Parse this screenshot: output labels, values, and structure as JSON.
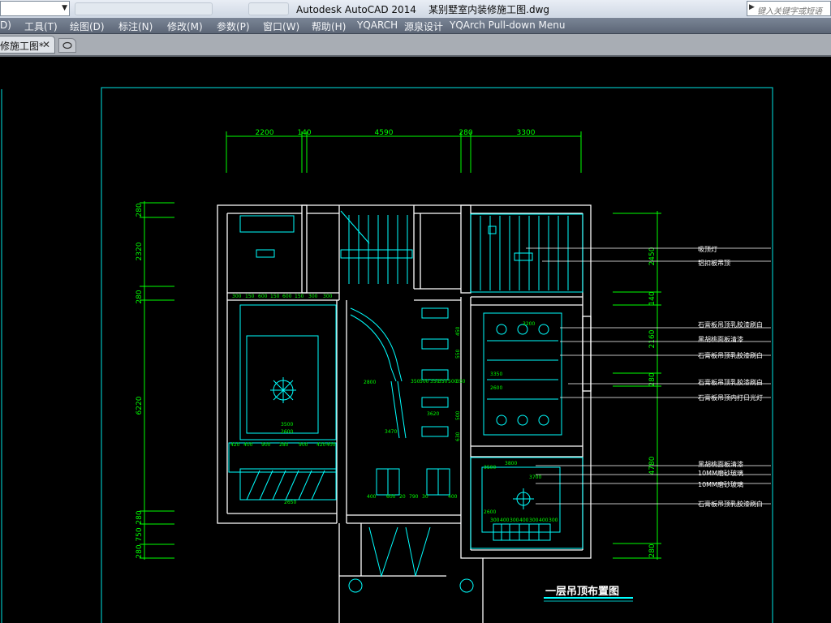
{
  "titlebar": {
    "workspace_value": "",
    "title": "Autodesk AutoCAD 2014    某别墅室内装修施工图.dwg",
    "search_placeholder": "键入关键字或短语"
  },
  "menu": {
    "items": [
      "D)",
      "工具(T)",
      "绘图(D)",
      "标注(N)",
      "修改(M)",
      "参数(P)",
      "窗口(W)",
      "帮助(H)",
      "YQARCH",
      "源泉设计",
      "YQArch Pull-down Menu"
    ]
  },
  "tabs": {
    "active_label": "修施工图*"
  },
  "drawing": {
    "title": "一层吊顶布置图",
    "colors": {
      "wall": "#ffffff",
      "dimension": "#00ff00",
      "detail": "#00ffff",
      "frame": "#00e5e5"
    },
    "top_dims": [
      "2200",
      "140",
      "4590",
      "280",
      "3300"
    ],
    "left_dims": [
      "280",
      "2320",
      "280",
      "6220",
      "280",
      "750",
      "280"
    ],
    "right_dims": [
      "2450",
      "140",
      "2160",
      "280",
      "4780",
      "280"
    ],
    "labels": [
      "吸顶灯",
      "铝扣板吊顶",
      "石膏板吊顶乳胶漆刷白",
      "黑胡桃面板清漆",
      "石膏板吊顶乳胶漆刷白",
      "石膏板吊顶乳胶漆刷白",
      "石膏板吊顶内打日光灯",
      "黑胡桃面板清漆",
      "10MM磨砂玻璃",
      "10MM磨砂玻璃",
      "石膏板吊顶乳胶漆刷白"
    ],
    "room_dims": {
      "living_top": [
        "300",
        "150",
        "600",
        "150",
        "600",
        "150",
        "300",
        "300"
      ],
      "living_bottom": [
        "420",
        "400",
        "900",
        "280",
        "900",
        "420",
        "400"
      ],
      "dining_bottom": [
        "400",
        "600",
        "20",
        "790",
        "30",
        "400"
      ],
      "bedroom_bottom": [
        "300",
        "400",
        "300",
        "400",
        "300",
        "400",
        "300"
      ],
      "heights": [
        "3200",
        "3350",
        "2600",
        "3620",
        "3470",
        "3500",
        "2600",
        "2800",
        "2650",
        "3800",
        "3700",
        "3500",
        "2600"
      ],
      "stair": [
        "350",
        "500",
        "350",
        "350",
        "500",
        "350",
        "450",
        "550",
        "500",
        "630"
      ]
    }
  }
}
